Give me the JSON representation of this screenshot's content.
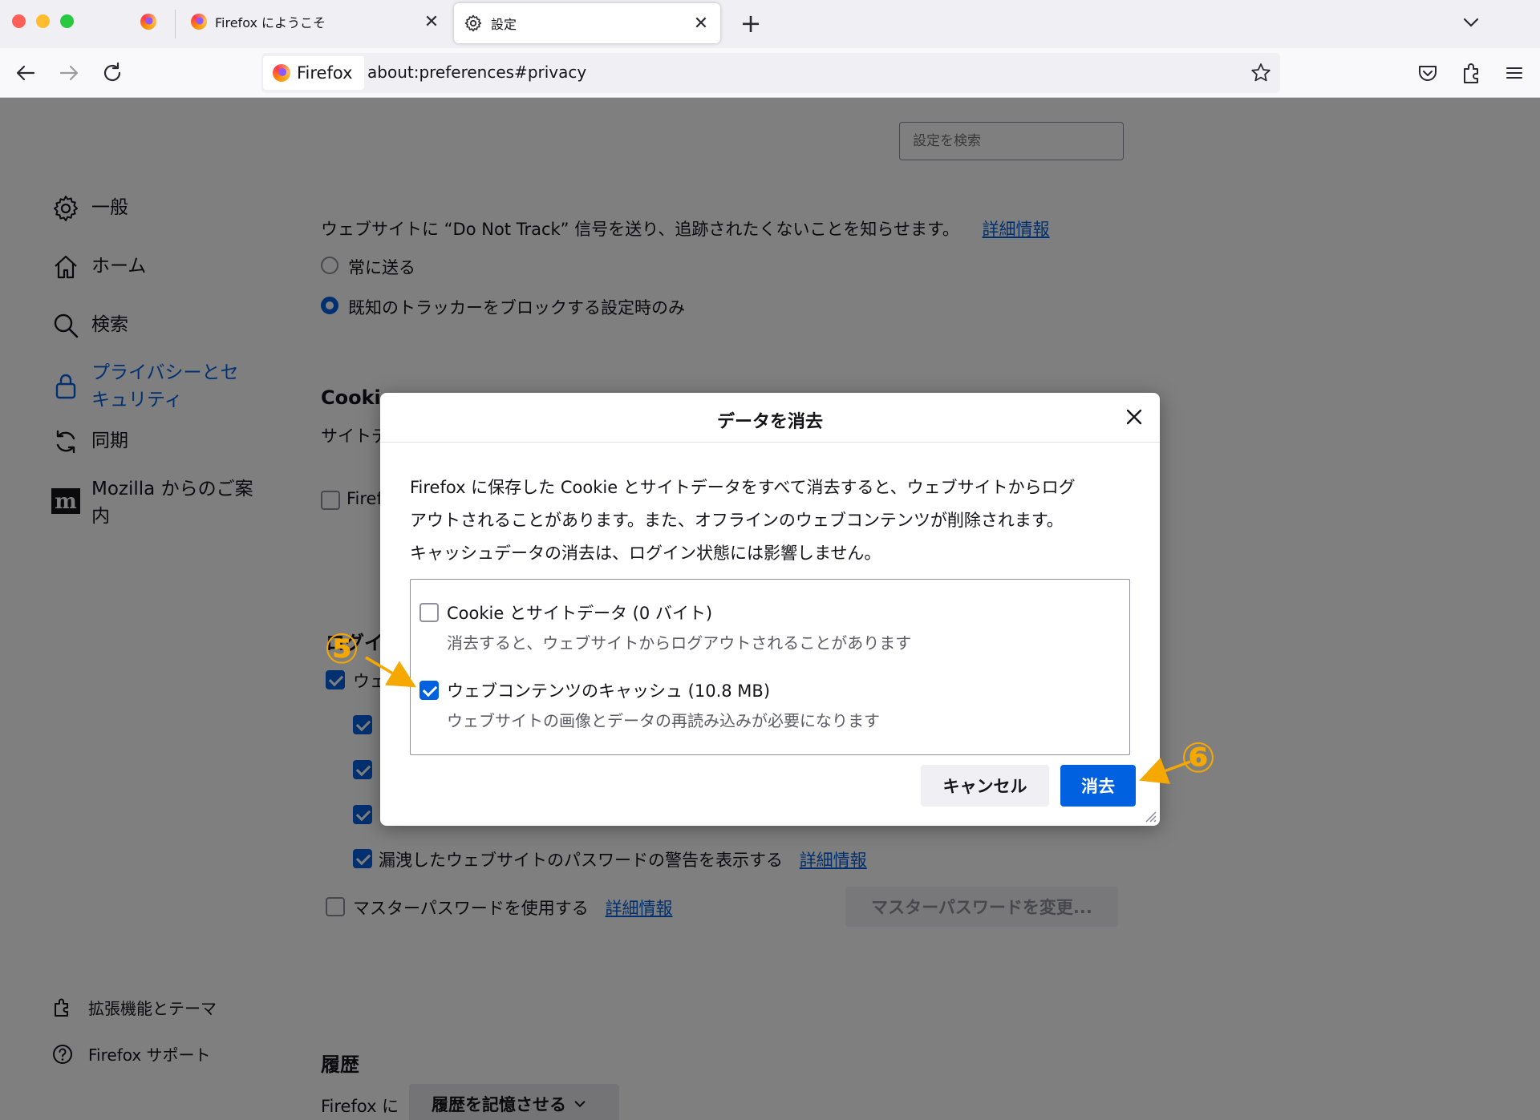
{
  "browser": {
    "tabs": [
      {
        "label": "",
        "pinned": true
      },
      {
        "label": "Firefox にようこそ"
      },
      {
        "label": "設定",
        "active": true
      }
    ],
    "tab_close_glyph": "✕",
    "new_tab_glyph": "+",
    "url": {
      "identity_label": "Firefox",
      "address": "about:preferences#privacy"
    }
  },
  "settings": {
    "search_placeholder": "設定を検索",
    "sidebar": [
      {
        "label": "一般",
        "icon": "gear-icon"
      },
      {
        "label": "ホーム",
        "icon": "home-icon"
      },
      {
        "label": "検索",
        "icon": "search-icon"
      },
      {
        "label_line1": "プライバシーとセ",
        "label_line2": "キュリティ",
        "icon": "lock-icon",
        "selected": true
      },
      {
        "label": "同期",
        "icon": "sync-icon"
      },
      {
        "label_line1": "Mozilla からのご案",
        "label_line2": "内",
        "icon": "mozilla-icon"
      }
    ],
    "sidebar_bottom": [
      {
        "label": "拡張機能とテーマ",
        "icon": "puzzle-icon"
      },
      {
        "label": "Firefox サポート",
        "icon": "help-icon"
      }
    ],
    "dnt": {
      "text": "ウェブサイトに “Do Not Track” 信号を送り、追跡されたくないことを知らせます。",
      "link": "詳細情報",
      "options": [
        {
          "label": "常に送る",
          "checked": false
        },
        {
          "label": "既知のトラッカーをブロックする設定時のみ",
          "checked": true
        }
      ]
    },
    "cookie_heading_partial": "Cookie",
    "cookie_text_partial": "サイトデ",
    "cookie_checkbox_partial": "Firef",
    "login_heading_partial": "ログイ",
    "login_cb_partial": "ウェ",
    "leak_label": "漏洩したウェブサイトのパスワードの警告を表示する",
    "leak_link": "詳細情報",
    "master_label": "マスターパスワードを使用する",
    "master_link": "詳細情報",
    "master_button": "マスターパスワードを変更...",
    "history_heading": "履歴",
    "history_prefix": "Firefox に",
    "history_select": "履歴を記憶させる"
  },
  "dialog": {
    "title": "データを消去",
    "description_lines": [
      "Firefox に保存した Cookie とサイトデータをすべて消去すると、ウェブサイトからログ",
      "アウトされることがあります。また、オフラインのウェブコンテンツが削除されます。",
      "キャッシュデータの消去は、ログイン状態には影響しません。"
    ],
    "options": [
      {
        "label": "Cookie とサイトデータ (0 バイト)",
        "sub": "消去すると、ウェブサイトからログアウトされることがあります",
        "checked": false
      },
      {
        "label": "ウェブコンテンツのキャッシュ (10.8 MB)",
        "sub": "ウェブサイトの画像とデータの再読み込みが必要になります",
        "checked": true
      }
    ],
    "cancel_label": "キャンセル",
    "clear_label": "消去"
  },
  "annotations": {
    "step5": "⑤",
    "step6": "⑥",
    "color": "#f5a800"
  },
  "colors": {
    "accent": "#0061e0",
    "overlay": "rgba(0,0,0,0.5)"
  }
}
